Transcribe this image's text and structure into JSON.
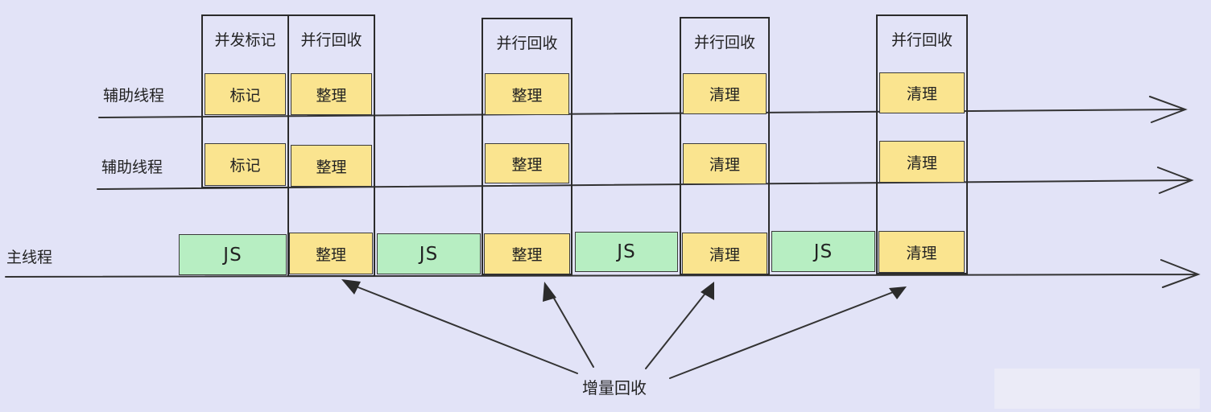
{
  "row_labels": {
    "helper_1": "辅助线程",
    "helper_2": "辅助线程",
    "main": "主线程"
  },
  "frames": [
    {
      "label": "并发标记"
    },
    {
      "label": "并行回收"
    },
    {
      "label": "并行回收"
    },
    {
      "label": "并行回收"
    },
    {
      "label": "并行回收"
    }
  ],
  "helper_row_1": [
    "标记",
    "整理",
    "整理",
    "清理",
    "清理"
  ],
  "helper_row_2": [
    "标记",
    "整理",
    "整理",
    "清理",
    "清理"
  ],
  "main_row": [
    "JS",
    "整理",
    "JS",
    "整理",
    "JS",
    "清理",
    "JS",
    "清理"
  ],
  "annotation": "增量回收",
  "colors": {
    "background": "#e2e3f7",
    "task_block": "#fae48f",
    "js_block": "#b7eec2",
    "stroke": "#2b2b2b"
  }
}
